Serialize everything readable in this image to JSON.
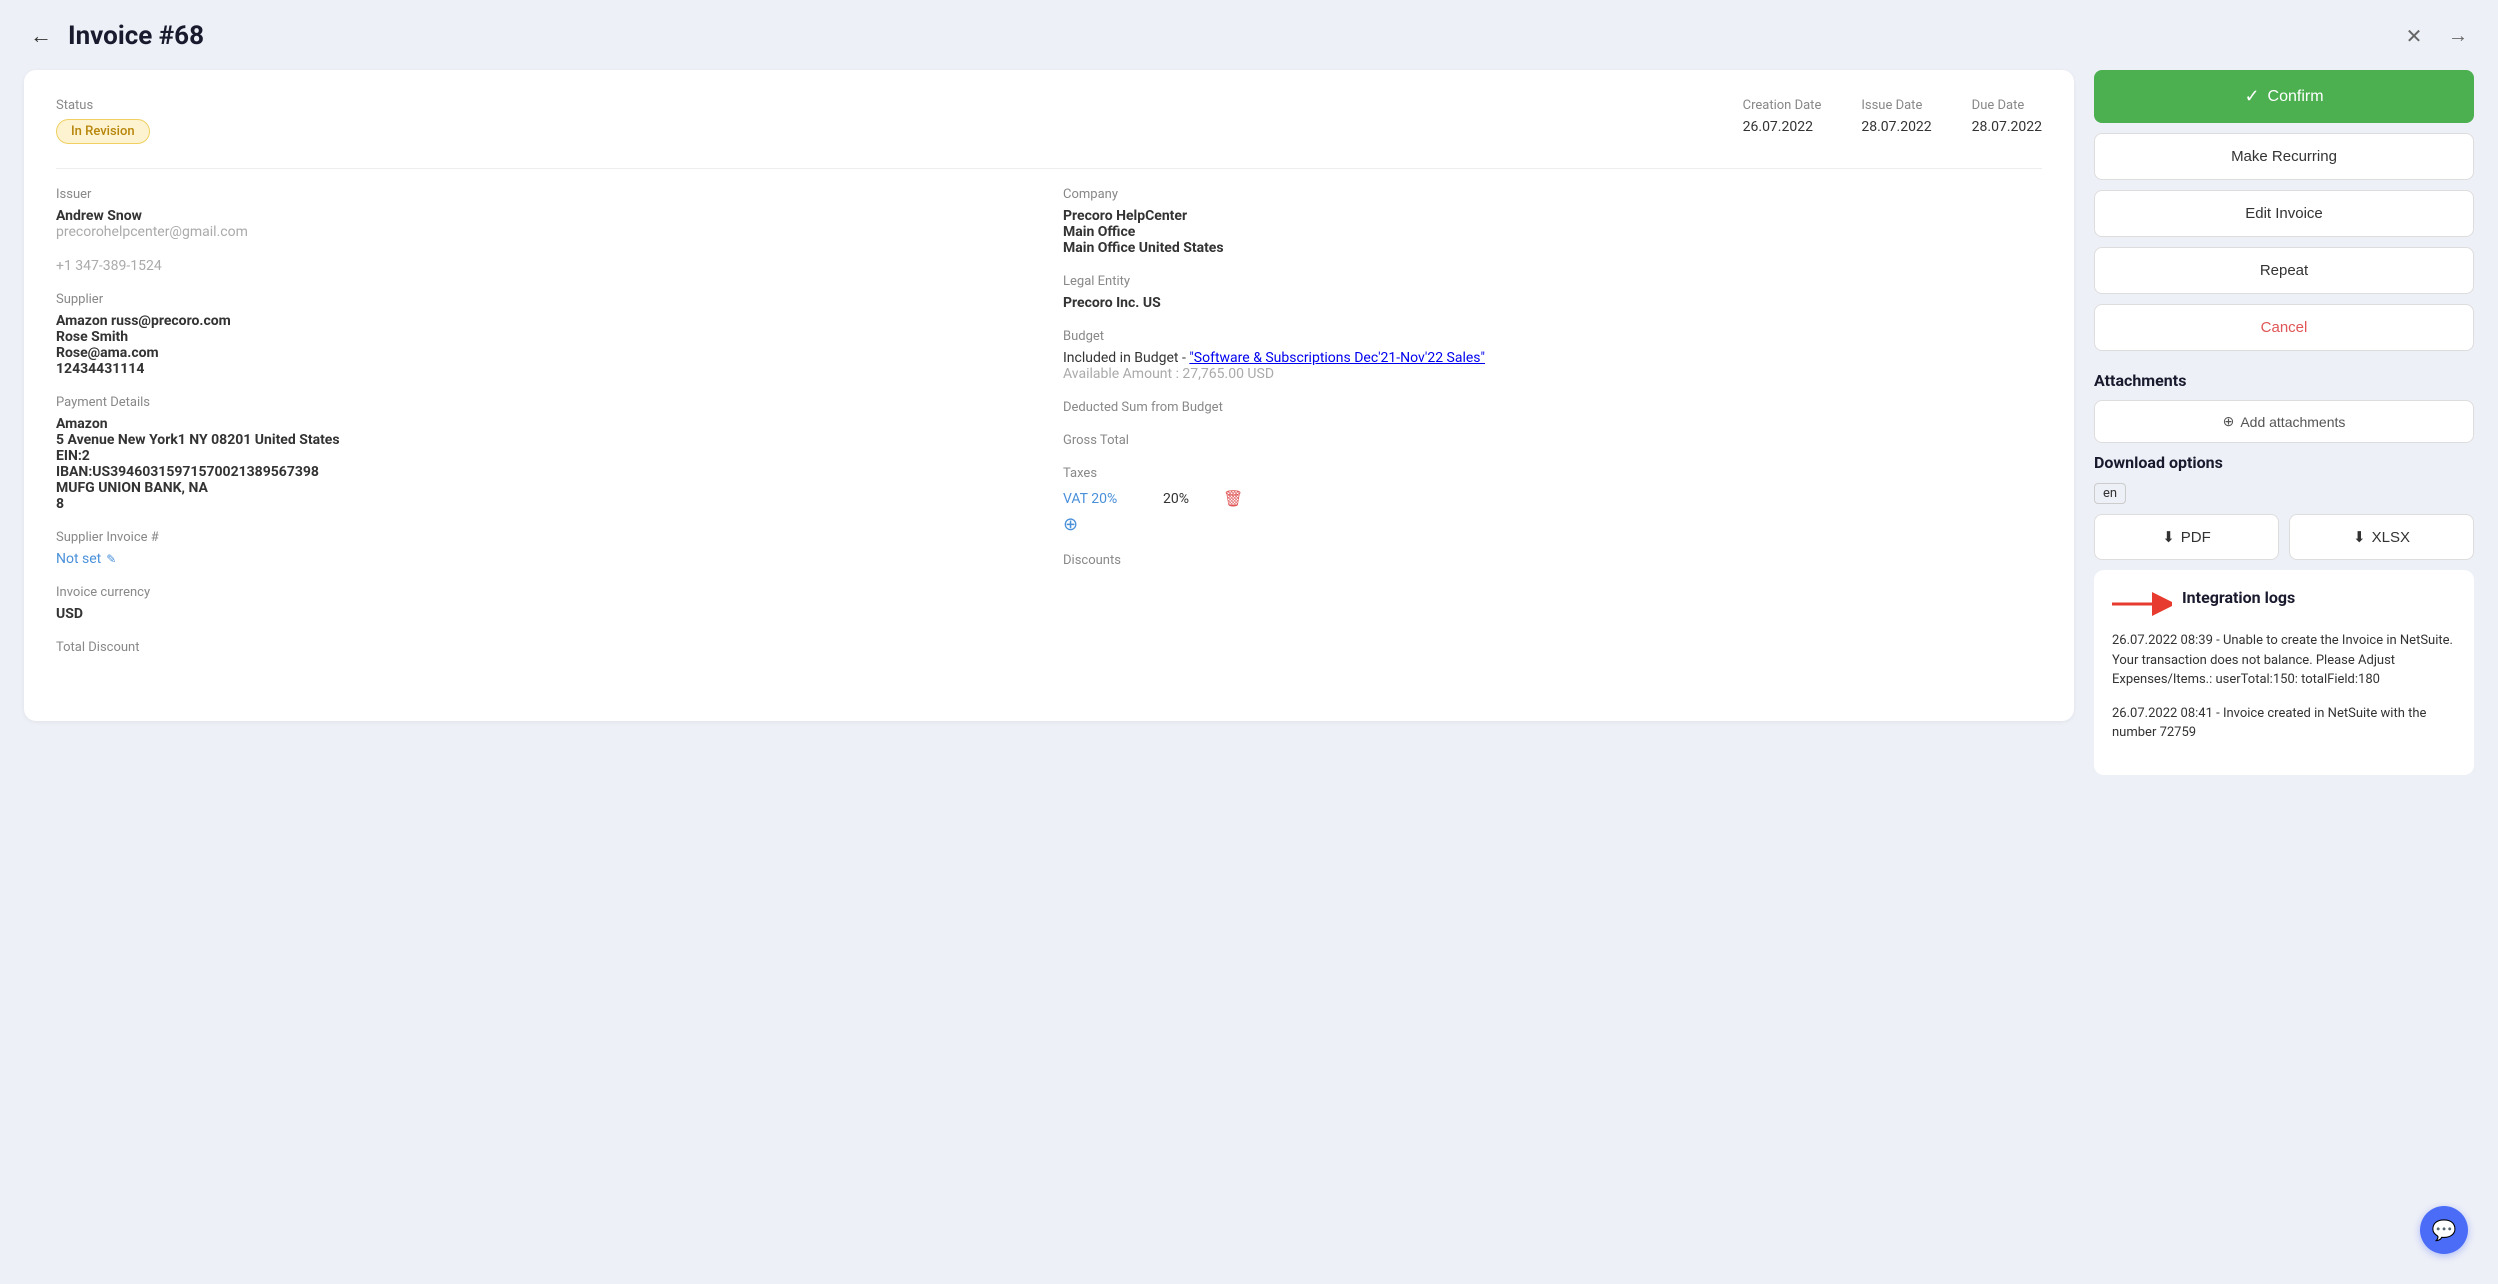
{
  "page": {
    "title": "Invoice #68",
    "back_label": "←",
    "close_icon": "✕",
    "forward_icon": "→"
  },
  "invoice": {
    "status_label": "Status",
    "status_value": "In Revision",
    "creation_date_label": "Creation Date",
    "creation_date_value": "26.07.2022",
    "issue_date_label": "Issue Date",
    "issue_date_value": "28.07.2022",
    "due_date_label": "Due Date",
    "due_date_value": "28.07.2022",
    "issuer_label": "Issuer",
    "issuer_name": "Andrew Snow",
    "issuer_email": "precorohelpcenter@gmail.com",
    "issuer_phone": "+1 347-389-1524",
    "supplier_label": "Supplier",
    "supplier_name": "Amazon russ@precoro.com",
    "supplier_contact": "Rose Smith",
    "supplier_email": "Rose@ama.com",
    "supplier_id": "12434431114",
    "payment_details_label": "Payment Details",
    "payment_name": "Amazon",
    "payment_address": "5 Avenue New York1 NY 08201 United States",
    "payment_ein": "EIN:2",
    "payment_iban": "IBAN:US39460315971570021389567398",
    "payment_bank": "MUFG UNION BANK, NA",
    "payment_code": "8",
    "supplier_invoice_label": "Supplier Invoice #",
    "supplier_invoice_value": "Not set",
    "invoice_currency_label": "Invoice currency",
    "invoice_currency_value": "USD",
    "total_discount_label": "Total Discount",
    "company_label": "Company",
    "company_name": "Precoro HelpCenter",
    "company_office": "Main Office",
    "company_location": "Main Office United States",
    "legal_entity_label": "Legal Entity",
    "legal_entity_value": "Precoro Inc. US",
    "budget_label": "Budget",
    "budget_text": "Included in Budget - ",
    "budget_link": "\"Software & Subscriptions Dec'21-Nov'22 Sales\"",
    "budget_available": "Available Amount : 27,765.00 USD",
    "deducted_sum_label": "Deducted Sum from Budget",
    "gross_total_label": "Gross Total",
    "taxes_label": "Taxes",
    "tax_name": "VAT 20%",
    "tax_pct": "20%",
    "discounts_label": "Discounts"
  },
  "actions": {
    "confirm_label": "Confirm",
    "make_recurring_label": "Make Recurring",
    "edit_invoice_label": "Edit Invoice",
    "repeat_label": "Repeat",
    "cancel_label": "Cancel"
  },
  "attachments": {
    "title": "Attachments",
    "add_label": "Add attachments"
  },
  "download": {
    "title": "Download options",
    "lang": "en",
    "pdf_label": "PDF",
    "xlsx_label": "XLSX"
  },
  "integration_logs": {
    "title": "Integration logs",
    "log1": "26.07.2022 08:39 - Unable to create the Invoice in NetSuite. Your transaction does not balance. Please Adjust Expenses/Items.: userTotal:150: totalField:180",
    "log2": "26.07.2022 08:41 - Invoice created in NetSuite with the number 72759"
  }
}
